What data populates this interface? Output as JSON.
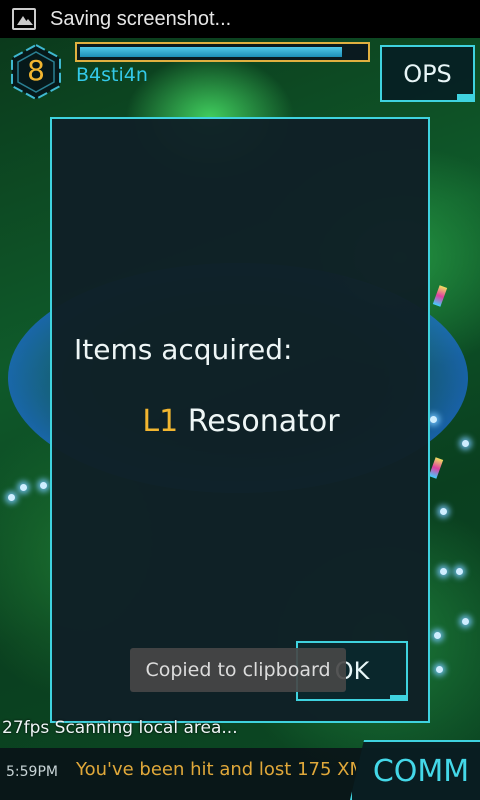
{
  "status_bar": {
    "icon": "image-icon",
    "text": "Saving screenshot..."
  },
  "player": {
    "level": "8",
    "name": "B4sti4n",
    "xp_progress": 0.92
  },
  "ops": {
    "label": "OPS"
  },
  "dialog": {
    "heading": "Items acquired:",
    "item_level": "L1",
    "item_name": "Resonator",
    "ok_label": "OK"
  },
  "toast": {
    "text": "Copied to clipboard"
  },
  "hud": {
    "scan_status": "27fps  Scanning local area..."
  },
  "comm": {
    "time": "5:59PM",
    "message": "You've been hit and lost 175 XM",
    "button_label": "COMM"
  },
  "colors": {
    "accent_cyan": "#3fd3df",
    "level_gold": "#f2b630",
    "agent_blue": "#33c9e8",
    "message_amber": "#e0a83a"
  }
}
